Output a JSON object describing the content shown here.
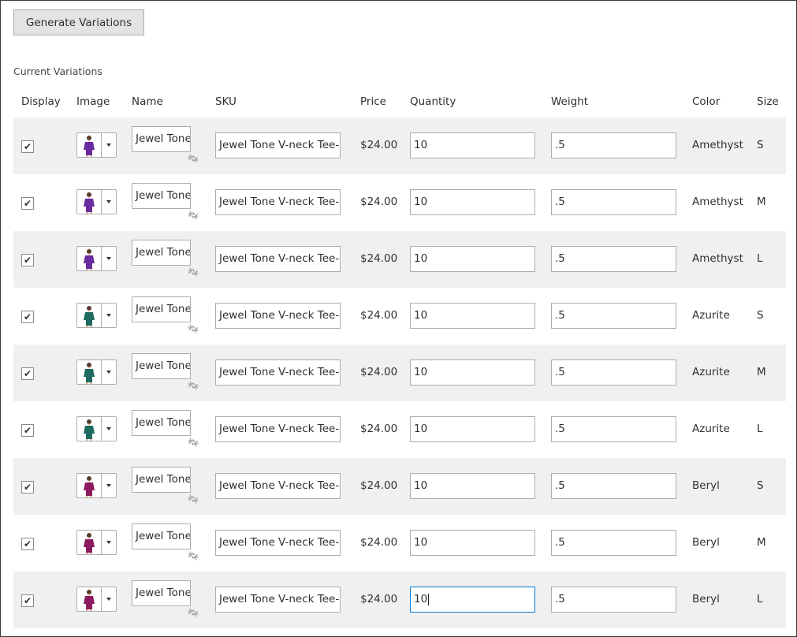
{
  "generate_button": "Generate Variations",
  "section_title": "Current Variations",
  "columns": {
    "display": "Display",
    "image": "Image",
    "name": "Name",
    "sku": "SKU",
    "price": "Price",
    "quantity": "Quantity",
    "weight": "Weight",
    "color": "Color",
    "size": "Size"
  },
  "color_swatches": {
    "Amethyst": "#6a2aa0",
    "Azurite": "#1d6a60",
    "Beryl": "#8c1a5e"
  },
  "rows": [
    {
      "checked": true,
      "name": "Jewel Tone",
      "sku": "Jewel Tone V-neck Tee-",
      "price": "$24.00",
      "quantity": "10",
      "weight": ".5",
      "color": "Amethyst",
      "size": "S"
    },
    {
      "checked": true,
      "name": "Jewel Tone",
      "sku": "Jewel Tone V-neck Tee-",
      "price": "$24.00",
      "quantity": "10",
      "weight": ".5",
      "color": "Amethyst",
      "size": "M"
    },
    {
      "checked": true,
      "name": "Jewel Tone",
      "sku": "Jewel Tone V-neck Tee-",
      "price": "$24.00",
      "quantity": "10",
      "weight": ".5",
      "color": "Amethyst",
      "size": "L"
    },
    {
      "checked": true,
      "name": "Jewel Tone",
      "sku": "Jewel Tone V-neck Tee-",
      "price": "$24.00",
      "quantity": "10",
      "weight": ".5",
      "color": "Azurite",
      "size": "S"
    },
    {
      "checked": true,
      "name": "Jewel Tone",
      "sku": "Jewel Tone V-neck Tee-",
      "price": "$24.00",
      "quantity": "10",
      "weight": ".5",
      "color": "Azurite",
      "size": "M"
    },
    {
      "checked": true,
      "name": "Jewel Tone",
      "sku": "Jewel Tone V-neck Tee-",
      "price": "$24.00",
      "quantity": "10",
      "weight": ".5",
      "color": "Azurite",
      "size": "L"
    },
    {
      "checked": true,
      "name": "Jewel Tone",
      "sku": "Jewel Tone V-neck Tee-",
      "price": "$24.00",
      "quantity": "10",
      "weight": ".5",
      "color": "Beryl",
      "size": "S"
    },
    {
      "checked": true,
      "name": "Jewel Tone",
      "sku": "Jewel Tone V-neck Tee-",
      "price": "$24.00",
      "quantity": "10",
      "weight": ".5",
      "color": "Beryl",
      "size": "M"
    },
    {
      "checked": true,
      "name": "Jewel Tone",
      "sku": "Jewel Tone V-neck Tee-",
      "price": "$24.00",
      "quantity": "10",
      "weight": ".5",
      "color": "Beryl",
      "size": "L",
      "focused": true
    }
  ]
}
